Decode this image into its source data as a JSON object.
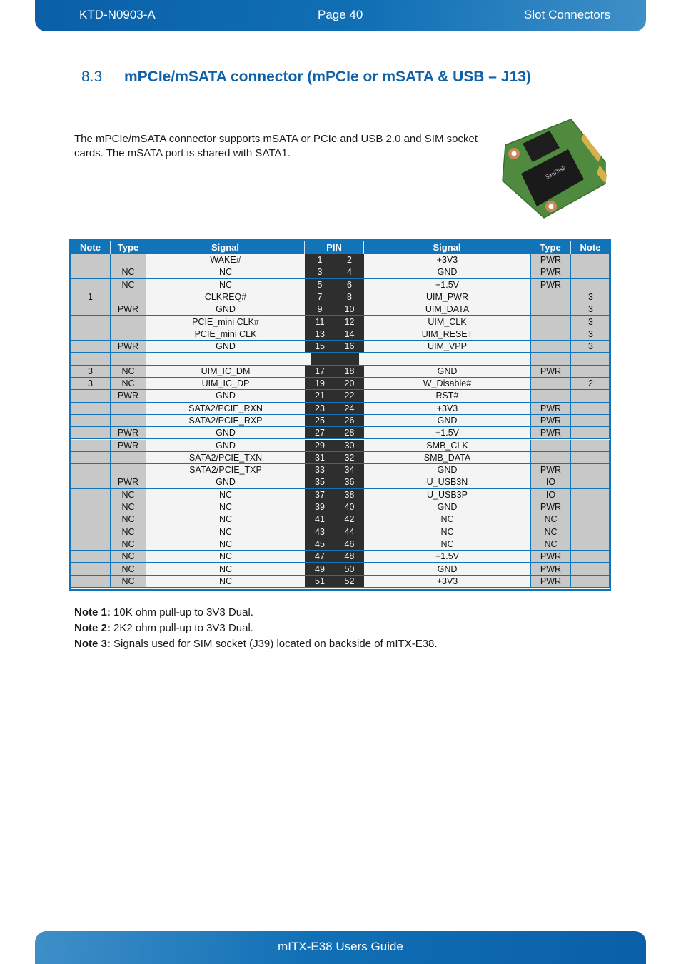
{
  "header": {
    "doc_id": "KTD-N0903-A",
    "page": "Page 40",
    "chapter": "Slot Connectors"
  },
  "section": {
    "number": "8.3",
    "title": "mPCIe/mSATA connector (mPCIe or mSATA & USB – J13)"
  },
  "intro_text": "The mPCIe/mSATA connector supports mSATA or PCIe and USB 2.0 and SIM socket cards. The mSATA port is shared with SATA1.",
  "image": {
    "alt": "mSATA card photo (SanDisk)",
    "icon": "msata-card-photo"
  },
  "table": {
    "headers": [
      "Note",
      "Type",
      "Signal",
      "PIN",
      "Signal",
      "Type",
      "Note"
    ],
    "rows": [
      {
        "ln": "",
        "lt": "",
        "ls": "WAKE#",
        "p1": "1",
        "p2": "2",
        "rs": "+3V3",
        "rt": "PWR",
        "rn": ""
      },
      {
        "ln": "",
        "lt": "NC",
        "ls": "NC",
        "p1": "3",
        "p2": "4",
        "rs": "GND",
        "rt": "PWR",
        "rn": ""
      },
      {
        "ln": "",
        "lt": "NC",
        "ls": "NC",
        "p1": "5",
        "p2": "6",
        "rs": "+1.5V",
        "rt": "PWR",
        "rn": ""
      },
      {
        "ln": "1",
        "lt": "",
        "ls": "CLKREQ#",
        "p1": "7",
        "p2": "8",
        "rs": "UIM_PWR",
        "rt": "",
        "rn": "3"
      },
      {
        "ln": "",
        "lt": "PWR",
        "ls": "GND",
        "p1": "9",
        "p2": "10",
        "rs": "UIM_DATA",
        "rt": "",
        "rn": "3"
      },
      {
        "ln": "",
        "lt": "",
        "ls": "PCIE_mini CLK#",
        "p1": "11",
        "p2": "12",
        "rs": "UIM_CLK",
        "rt": "",
        "rn": "3"
      },
      {
        "ln": "",
        "lt": "",
        "ls": "PCIE_mini CLK",
        "p1": "13",
        "p2": "14",
        "rs": "UIM_RESET",
        "rt": "",
        "rn": "3"
      },
      {
        "ln": "",
        "lt": "PWR",
        "ls": "GND",
        "p1": "15",
        "p2": "16",
        "rs": "UIM_VPP",
        "rt": "",
        "rn": "3"
      },
      {
        "gap": true,
        "ln": "",
        "lt": "",
        "ls": "",
        "p1": "",
        "p2": "",
        "rs": "",
        "rt": "",
        "rn": ""
      },
      {
        "ln": "3",
        "lt": "NC",
        "ls": "UIM_IC_DM",
        "p1": "17",
        "p2": "18",
        "rs": "GND",
        "rt": "PWR",
        "rn": ""
      },
      {
        "ln": "3",
        "lt": "NC",
        "ls": "UIM_IC_DP",
        "p1": "19",
        "p2": "20",
        "rs": "W_Disable#",
        "rt": "",
        "rn": "2"
      },
      {
        "ln": "",
        "lt": "PWR",
        "ls": "GND",
        "p1": "21",
        "p2": "22",
        "rs": "RST#",
        "rt": "",
        "rn": ""
      },
      {
        "ln": "",
        "lt": "",
        "ls": "SATA2/PCIE_RXN",
        "p1": "23",
        "p2": "24",
        "rs": "+3V3",
        "rt": "PWR",
        "rn": ""
      },
      {
        "ln": "",
        "lt": "",
        "ls": "SATA2/PCIE_RXP",
        "p1": "25",
        "p2": "26",
        "rs": "GND",
        "rt": "PWR",
        "rn": ""
      },
      {
        "ln": "",
        "lt": "PWR",
        "ls": "GND",
        "p1": "27",
        "p2": "28",
        "rs": "+1.5V",
        "rt": "PWR",
        "rn": ""
      },
      {
        "ln": "",
        "lt": "PWR",
        "ls": "GND",
        "p1": "29",
        "p2": "30",
        "rs": "SMB_CLK",
        "rt": "",
        "rn": ""
      },
      {
        "ln": "",
        "lt": "",
        "ls": "SATA2/PCIE_TXN",
        "p1": "31",
        "p2": "32",
        "rs": "SMB_DATA",
        "rt": "",
        "rn": ""
      },
      {
        "ln": "",
        "lt": "",
        "ls": "SATA2/PCIE_TXP",
        "p1": "33",
        "p2": "34",
        "rs": "GND",
        "rt": "PWR",
        "rn": ""
      },
      {
        "ln": "",
        "lt": "PWR",
        "ls": "GND",
        "p1": "35",
        "p2": "36",
        "rs": "U_USB3N",
        "rt": "IO",
        "rn": ""
      },
      {
        "ln": "",
        "lt": "NC",
        "ls": "NC",
        "p1": "37",
        "p2": "38",
        "rs": "U_USB3P",
        "rt": "IO",
        "rn": ""
      },
      {
        "ln": "",
        "lt": "NC",
        "ls": "NC",
        "p1": "39",
        "p2": "40",
        "rs": "GND",
        "rt": "PWR",
        "rn": ""
      },
      {
        "ln": "",
        "lt": "NC",
        "ls": "NC",
        "p1": "41",
        "p2": "42",
        "rs": "NC",
        "rt": "NC",
        "rn": ""
      },
      {
        "ln": "",
        "lt": "NC",
        "ls": "NC",
        "p1": "43",
        "p2": "44",
        "rs": "NC",
        "rt": "NC",
        "rn": ""
      },
      {
        "ln": "",
        "lt": "NC",
        "ls": "NC",
        "p1": "45",
        "p2": "46",
        "rs": "NC",
        "rt": "NC",
        "rn": ""
      },
      {
        "ln": "",
        "lt": "NC",
        "ls": "NC",
        "p1": "47",
        "p2": "48",
        "rs": "+1.5V",
        "rt": "PWR",
        "rn": ""
      },
      {
        "ln": "",
        "lt": "NC",
        "ls": "NC",
        "p1": "49",
        "p2": "50",
        "rs": "GND",
        "rt": "PWR",
        "rn": ""
      },
      {
        "ln": "",
        "lt": "NC",
        "ls": "NC",
        "p1": "51",
        "p2": "52",
        "rs": "+3V3",
        "rt": "PWR",
        "rn": ""
      }
    ]
  },
  "notes": [
    {
      "label": "Note 1:",
      "text": " 10K ohm pull-up to 3V3 Dual."
    },
    {
      "label": "Note 2:",
      "text": " 2K2 ohm pull-up to 3V3 Dual."
    },
    {
      "label": "Note 3:",
      "text": " Signals used for SIM socket (J39) located on backside of mITX-E38."
    }
  ],
  "footer": {
    "title": "mITX-E38 Users Guide"
  },
  "colors": {
    "brand_blue": "#1173b8",
    "pin_dark": "#2e2e2e",
    "cell_gray": "#c8c8c8"
  }
}
